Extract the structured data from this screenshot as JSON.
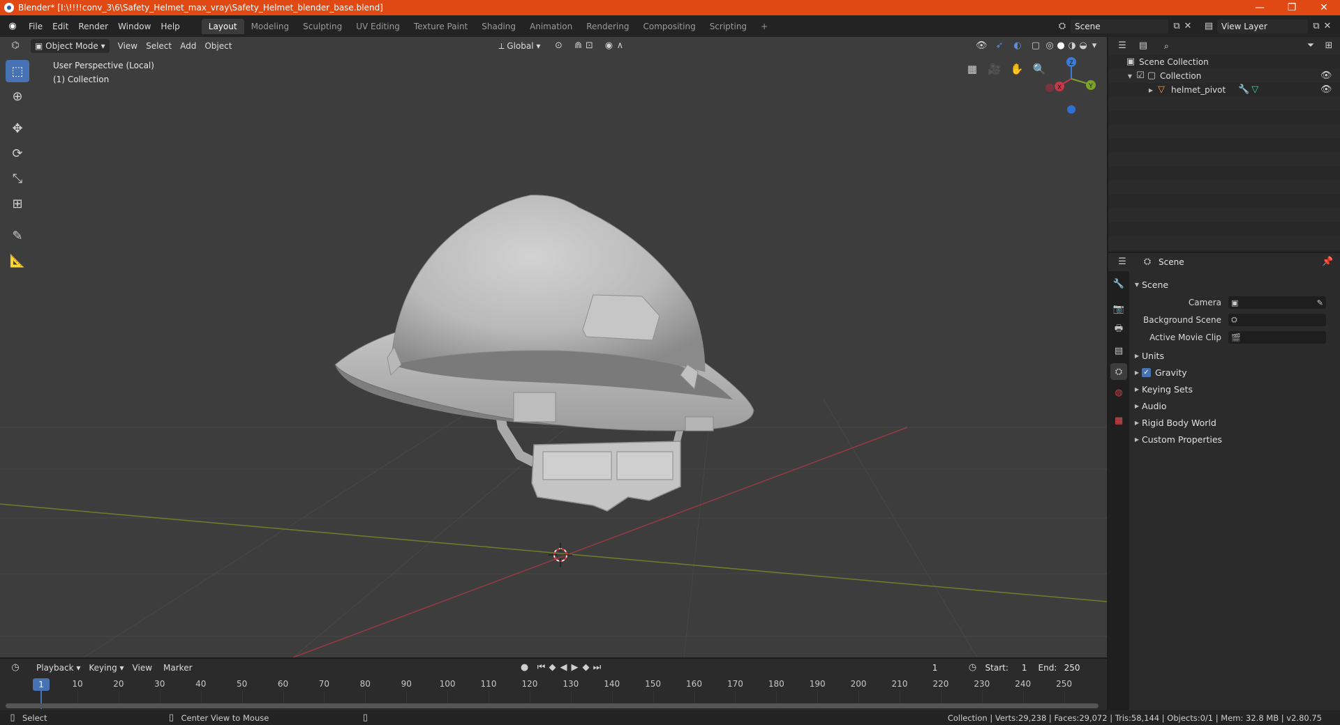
{
  "window": {
    "title": "Blender* [I:\\!!!!conv_3\\6\\Safety_Helmet_max_vray\\Safety_Helmet_blender_base.blend]",
    "minimize": "—",
    "restore": "❐",
    "close": "✕"
  },
  "menu": [
    "File",
    "Edit",
    "Render",
    "Window",
    "Help"
  ],
  "workspaces": [
    "Layout",
    "Modeling",
    "Sculpting",
    "UV Editing",
    "Texture Paint",
    "Shading",
    "Animation",
    "Rendering",
    "Compositing",
    "Scripting"
  ],
  "workspace_add": "+",
  "scene_selector": {
    "value": "Scene"
  },
  "view_layer_selector": {
    "value": "View Layer"
  },
  "viewport_header": {
    "mode": "Object Mode",
    "menus": [
      "View",
      "Select",
      "Add",
      "Object"
    ],
    "transform_orientation": "Global"
  },
  "viewport": {
    "info_line1": "User Perspective (Local)",
    "info_line2": "(1) Collection",
    "gizmo": {
      "x": "X",
      "y": "Y",
      "z": "Z"
    }
  },
  "outliner": {
    "search_placeholder": "",
    "items": [
      {
        "label": "Scene Collection",
        "level": 0
      },
      {
        "label": "Collection",
        "level": 1
      },
      {
        "label": "helmet_pivot",
        "level": 2
      }
    ]
  },
  "properties": {
    "header_title": "Scene",
    "panel_title": "Scene",
    "rows": [
      {
        "label": "Camera"
      },
      {
        "label": "Background Scene"
      },
      {
        "label": "Active Movie Clip"
      }
    ],
    "subpanels": [
      "Units",
      "Gravity",
      "Keying Sets",
      "Audio",
      "Rigid Body World",
      "Custom Properties"
    ],
    "gravity_checked": true
  },
  "timeline": {
    "menus": [
      "Playback",
      "Keying",
      "View",
      "Marker"
    ],
    "current_frame": "1",
    "start_label": "Start:",
    "start": "1",
    "end_label": "End:",
    "end": "250",
    "ruler": [
      "10",
      "20",
      "30",
      "40",
      "50",
      "60",
      "70",
      "80",
      "90",
      "100",
      "110",
      "120",
      "130",
      "140",
      "150",
      "160",
      "170",
      "180",
      "190",
      "200",
      "210",
      "220",
      "230",
      "240",
      "250"
    ],
    "cursor_label": "1"
  },
  "statusbar": {
    "left_action": "Select",
    "middle_action": "Center View to Mouse",
    "stats": "Collection | Verts:29,238 | Faces:29,072 | Tris:58,144 | Objects:0/1 | Mem: 32.8 MB | v2.80.75"
  },
  "colors": {
    "accent": "#4772b3",
    "titlebar": "#e04814",
    "viewport_bg": "#3d3d3d",
    "x_axis": "#c4384a",
    "y_axis": "#7da22a",
    "z_axis": "#3c7ad8"
  }
}
